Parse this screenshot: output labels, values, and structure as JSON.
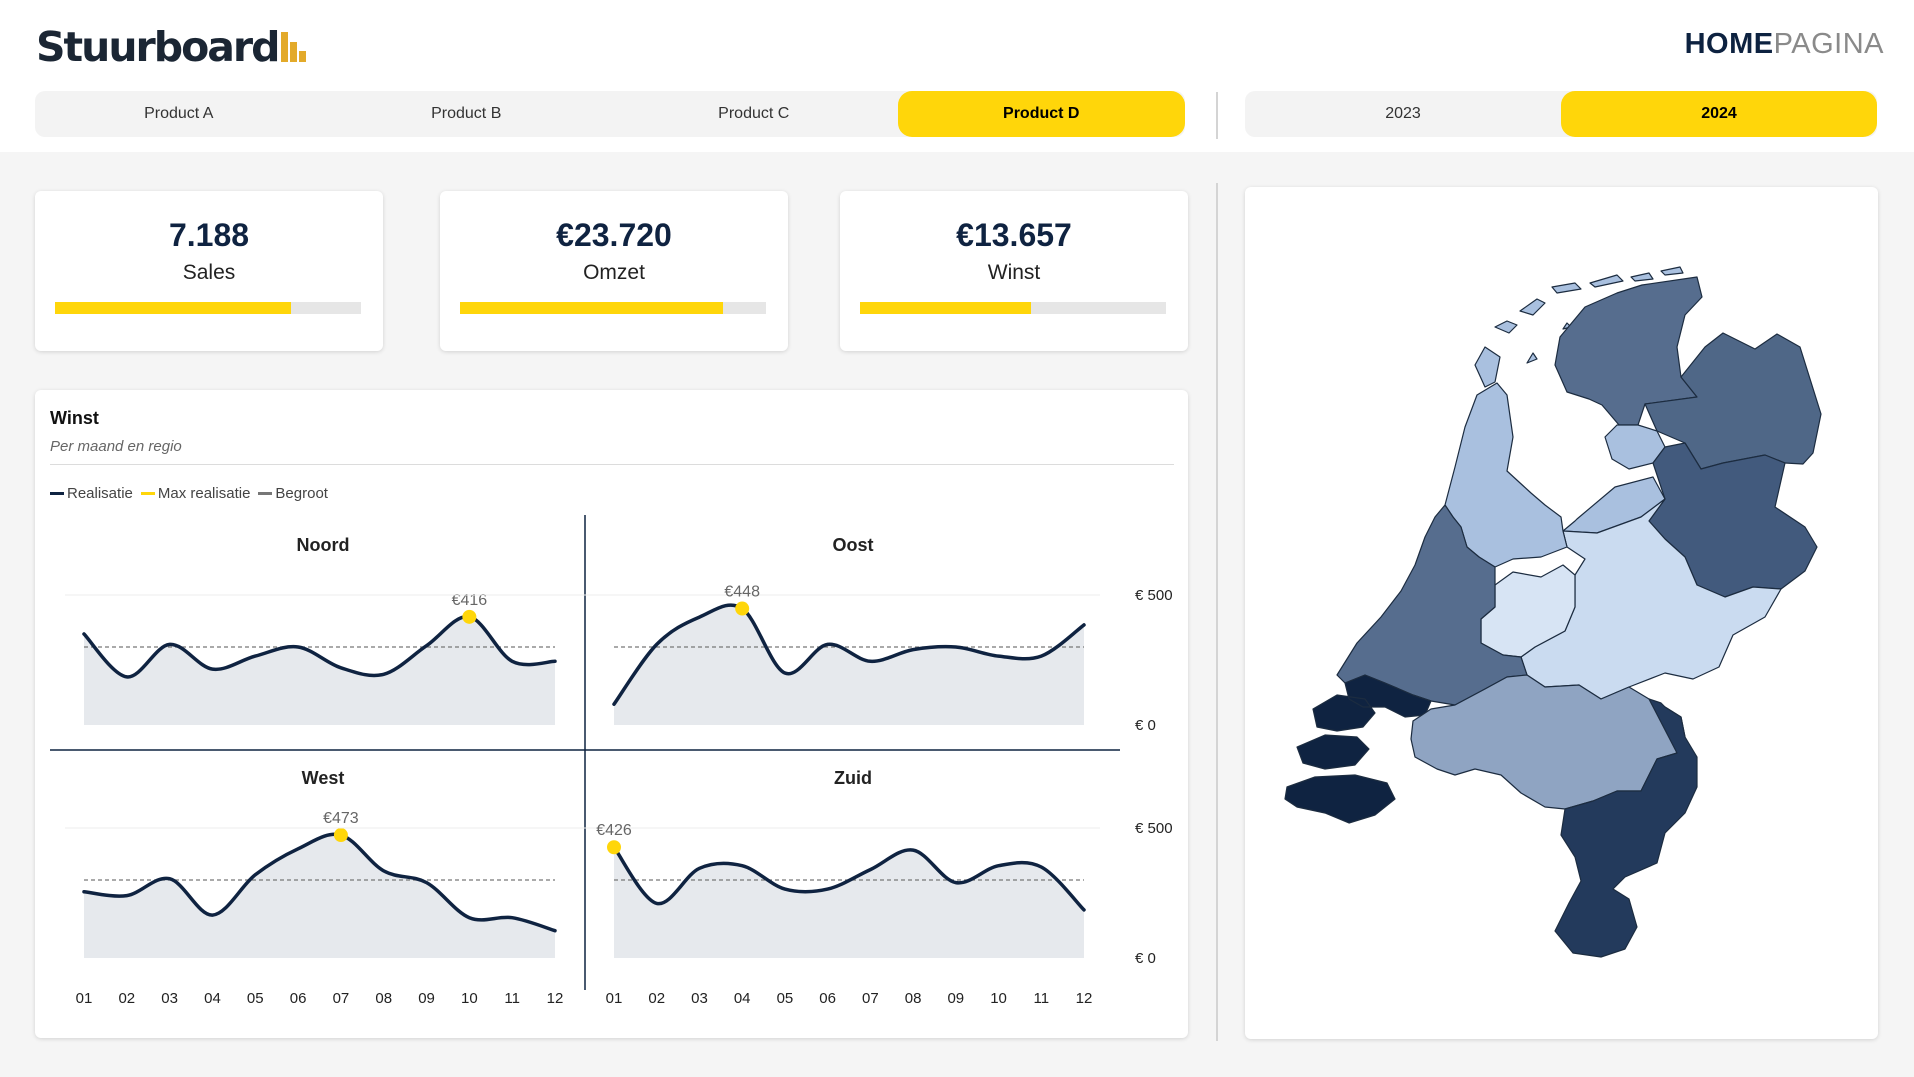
{
  "header": {
    "logo_text": "Stuurboard",
    "home_bold": "HOME",
    "home_rest": "PAGINA"
  },
  "products": [
    {
      "label": "Product A",
      "selected": false
    },
    {
      "label": "Product B",
      "selected": false
    },
    {
      "label": "Product C",
      "selected": false
    },
    {
      "label": "Product D",
      "selected": true
    }
  ],
  "years": [
    {
      "label": "2023",
      "selected": false
    },
    {
      "label": "2024",
      "selected": true
    }
  ],
  "kpis": [
    {
      "value": "7.188",
      "label": "Sales",
      "progress": 0.77
    },
    {
      "value": "€23.720",
      "label": "Omzet",
      "progress": 0.86
    },
    {
      "value": "€13.657",
      "label": "Winst",
      "progress": 0.56
    }
  ],
  "winst_chart": {
    "title": "Winst",
    "subtitle": "Per maand en regio",
    "legend": [
      {
        "label": "Realisatie",
        "color": "#0f2341"
      },
      {
        "label": "Max realisatie",
        "color": "#ffd60a"
      },
      {
        "label": "Begroot",
        "color": "#777777"
      }
    ]
  },
  "chart_data": {
    "type": "line",
    "x": [
      "01",
      "02",
      "03",
      "04",
      "05",
      "06",
      "07",
      "08",
      "09",
      "10",
      "11",
      "12"
    ],
    "y_ticks": [
      "€ 0",
      "€ 500"
    ],
    "ylim": [
      0,
      500
    ],
    "colors": {
      "realisatie": "#0f2341",
      "max": "#ffd60a",
      "begroot": "#777777",
      "area": "#e6e9ed"
    },
    "panels": [
      {
        "name": "Noord",
        "budget": 300,
        "values": [
          350,
          185,
          310,
          215,
          265,
          300,
          220,
          195,
          305,
          416,
          245,
          245
        ],
        "max_label": "€416",
        "max_index": 9
      },
      {
        "name": "Oost",
        "budget": 300,
        "values": [
          80,
          310,
          415,
          448,
          200,
          310,
          245,
          290,
          300,
          265,
          265,
          385
        ],
        "max_label": "€448",
        "max_index": 3
      },
      {
        "name": "West",
        "budget": 300,
        "values": [
          255,
          240,
          305,
          165,
          320,
          420,
          473,
          335,
          290,
          155,
          155,
          105
        ],
        "max_label": "€473",
        "max_index": 6
      },
      {
        "name": "Zuid",
        "budget": 300,
        "values": [
          426,
          210,
          345,
          355,
          265,
          265,
          340,
          415,
          290,
          355,
          350,
          185
        ],
        "max_label": "€426",
        "max_index": 0
      }
    ]
  },
  "map": {
    "regions": [
      {
        "name": "Groningen",
        "color": "#ccdcf2"
      },
      {
        "name": "Friesland",
        "color": "#566d8e"
      },
      {
        "name": "Drenthe",
        "color": "#4f6787"
      },
      {
        "name": "Overijssel",
        "color": "#425a7d"
      },
      {
        "name": "Flevoland",
        "color": "#a9c0df"
      },
      {
        "name": "Gelderland",
        "color": "#cadbf0"
      },
      {
        "name": "Utrecht",
        "color": "#d7e4f4"
      },
      {
        "name": "Noord-Holland",
        "color": "#a9c0df"
      },
      {
        "name": "Zuid-Holland",
        "color": "#566d8e"
      },
      {
        "name": "Zeeland",
        "color": "#0f2341"
      },
      {
        "name": "Noord-Brabant",
        "color": "#8fa4c2"
      },
      {
        "name": "Limburg",
        "color": "#233a5c"
      },
      {
        "name": "Waddeneilanden",
        "color": "#a9c0df"
      }
    ]
  }
}
